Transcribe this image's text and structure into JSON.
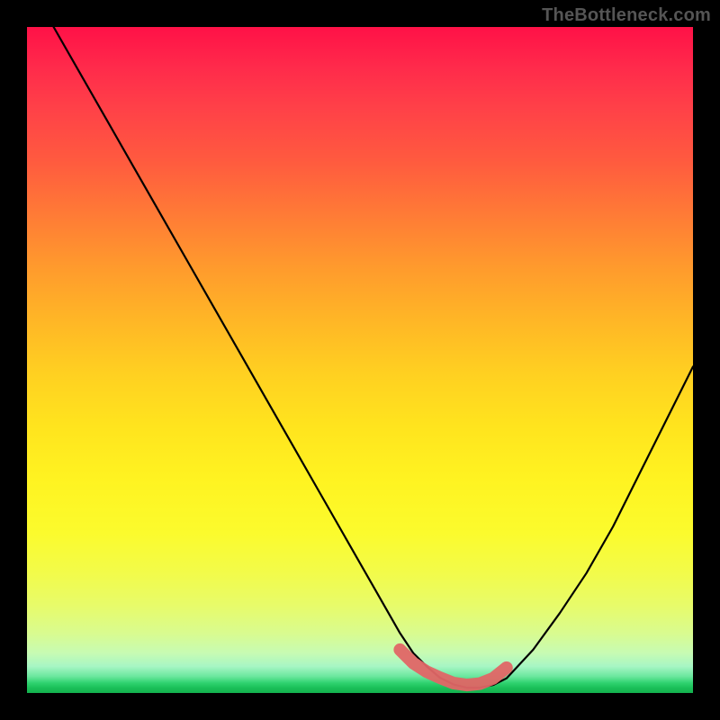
{
  "watermark": "TheBottleneck.com",
  "chart_data": {
    "type": "line",
    "title": "",
    "xlabel": "",
    "ylabel": "",
    "xlim": [
      0,
      100
    ],
    "ylim": [
      0,
      100
    ],
    "grid": false,
    "series": [
      {
        "name": "bottleneck-curve",
        "x": [
          4,
          8,
          12,
          16,
          20,
          24,
          28,
          32,
          36,
          40,
          44,
          48,
          52,
          56,
          58,
          60,
          62,
          64,
          66,
          68,
          70,
          72,
          76,
          80,
          84,
          88,
          92,
          96,
          100
        ],
        "values": [
          100,
          93,
          86,
          79,
          72,
          65,
          58,
          51,
          44,
          37,
          30,
          23,
          16,
          9,
          6,
          4,
          2.3,
          1.3,
          0.8,
          0.8,
          1.2,
          2.2,
          6.5,
          12,
          18,
          25,
          33,
          41,
          49
        ]
      },
      {
        "name": "optimal-marker",
        "x": [
          56,
          58,
          60,
          62,
          64,
          66,
          68,
          70,
          72
        ],
        "values": [
          6.5,
          4.5,
          3.2,
          2.3,
          1.5,
          1.2,
          1.4,
          2.2,
          3.8
        ]
      }
    ],
    "colors": {
      "curve": "#000000",
      "marker": "#e06666"
    }
  }
}
